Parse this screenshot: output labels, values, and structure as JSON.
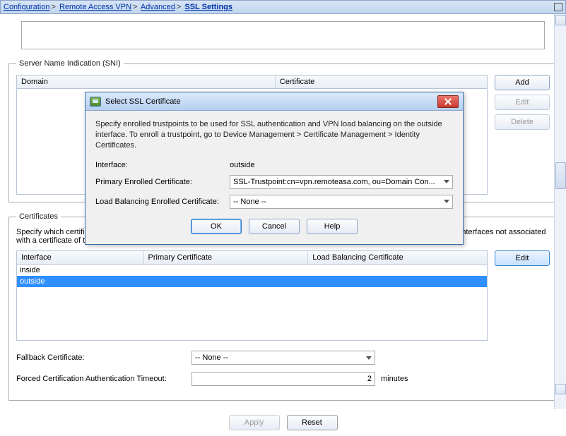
{
  "breadcrumbs": [
    "Configuration",
    "Remote Access VPN",
    "Advanced",
    "SSL Settings"
  ],
  "sections": {
    "sni": {
      "legend": "Server Name Indication (SNI)",
      "columns": [
        "Domain",
        "Certificate"
      ],
      "buttons": {
        "add": "Add",
        "edit": "Edit",
        "delete": "Delete"
      }
    },
    "certs": {
      "legend": "Certificates",
      "description": "Specify which certificates, if any, should be used for SSL authentication on each interface. The fallback certificate will be used on interfaces not associated with a certificate of their own.",
      "columns": [
        "Interface",
        "Primary Certificate",
        "Load Balancing Certificate"
      ],
      "rows": [
        {
          "iface": "inside",
          "primary": "",
          "lb": ""
        },
        {
          "iface": "outside",
          "primary": "",
          "lb": ""
        }
      ],
      "edit": "Edit"
    },
    "fallback": {
      "label": "Fallback Certificate:",
      "value": "-- None --"
    },
    "timeout": {
      "label": "Forced Certification Authentication Timeout:",
      "value": "2",
      "unit": "minutes"
    }
  },
  "footer": {
    "apply": "Apply",
    "reset": "Reset"
  },
  "dialog": {
    "title": "Select SSL Certificate",
    "text": "Specify enrolled trustpoints to be used for SSL authentication and VPN load balancing on the outside interface. To enroll a trustpoint, go to Device Management > Certificate Management > Identity Certificates.",
    "iface_label": "Interface:",
    "iface_value": "outside",
    "primary_label": "Primary Enrolled Certificate:",
    "primary_value": "SSL-Trustpoint:cn=vpn.remoteasa.com, ou=Domain Con...",
    "lb_label": "Load Balancing Enrolled Certificate:",
    "lb_value": "-- None --",
    "ok": "OK",
    "cancel": "Cancel",
    "help": "Help"
  }
}
